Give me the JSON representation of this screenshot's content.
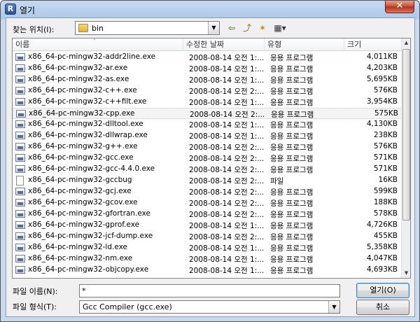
{
  "window": {
    "title": "열기",
    "app_icon_letter": "R",
    "close_glyph": "✕"
  },
  "lookin": {
    "label": "찾는 위치(I):",
    "value": "bin",
    "dropdown_glyph": "▼"
  },
  "toolbar": {
    "back_glyph": "⇦",
    "up_glyph": "⤴",
    "newfolder_glyph": "✶",
    "view_glyph": "▦▾"
  },
  "columns": {
    "name": "이름",
    "date": "수정한 날짜",
    "type": "유형",
    "size": "크기",
    "sort_glyph": "ˆ"
  },
  "files": [
    {
      "name": "x86_64-pc-mingw32-addr2line.exe",
      "date": "2008-08-14 오전 1:...",
      "type": "응용 프로그램",
      "size": "4,011KB",
      "icon": "exe"
    },
    {
      "name": "x86_64-pc-mingw32-ar.exe",
      "date": "2008-08-14 오전 1:...",
      "type": "응용 프로그램",
      "size": "4,203KB",
      "icon": "exe"
    },
    {
      "name": "x86_64-pc-mingw32-as.exe",
      "date": "2008-08-14 오전 1:...",
      "type": "응용 프로그램",
      "size": "5,695KB",
      "icon": "exe"
    },
    {
      "name": "x86_64-pc-mingw32-c++.exe",
      "date": "2008-08-14 오전 2:...",
      "type": "응용 프로그램",
      "size": "576KB",
      "icon": "exe"
    },
    {
      "name": "x86_64-pc-mingw32-c++filt.exe",
      "date": "2008-08-14 오전 1:...",
      "type": "응용 프로그램",
      "size": "3,954KB",
      "icon": "exe"
    },
    {
      "name": "x86_64-pc-mingw32-cpp.exe",
      "date": "2008-08-14 오전 2:...",
      "type": "응용 프로그램",
      "size": "575KB",
      "icon": "exe",
      "selected": true
    },
    {
      "name": "x86_64-pc-mingw32-dlltool.exe",
      "date": "2008-08-14 오전 1:...",
      "type": "응용 프로그램",
      "size": "4,130KB",
      "icon": "exe"
    },
    {
      "name": "x86_64-pc-mingw32-dllwrap.exe",
      "date": "2008-08-14 오전 1:...",
      "type": "응용 프로그램",
      "size": "238KB",
      "icon": "exe"
    },
    {
      "name": "x86_64-pc-mingw32-g++.exe",
      "date": "2008-08-14 오전 2:...",
      "type": "응용 프로그램",
      "size": "576KB",
      "icon": "exe"
    },
    {
      "name": "x86_64-pc-mingw32-gcc.exe",
      "date": "2008-08-14 오전 2:...",
      "type": "응용 프로그램",
      "size": "571KB",
      "icon": "exe"
    },
    {
      "name": "x86_64-pc-mingw32-gcc-4.4.0.exe",
      "date": "2008-08-14 오전 2:...",
      "type": "응용 프로그램",
      "size": "571KB",
      "icon": "exe"
    },
    {
      "name": "x86_64-pc-mingw32-gccbug",
      "date": "2008-08-14 오전 2:...",
      "type": "파일",
      "size": "16KB",
      "icon": "file"
    },
    {
      "name": "x86_64-pc-mingw32-gcj.exe",
      "date": "2008-08-14 오전 2:...",
      "type": "응용 프로그램",
      "size": "599KB",
      "icon": "exe"
    },
    {
      "name": "x86_64-pc-mingw32-gcov.exe",
      "date": "2008-08-14 오전 2:...",
      "type": "응용 프로그램",
      "size": "188KB",
      "icon": "exe"
    },
    {
      "name": "x86_64-pc-mingw32-gfortran.exe",
      "date": "2008-08-14 오전 2:...",
      "type": "응용 프로그램",
      "size": "578KB",
      "icon": "exe"
    },
    {
      "name": "x86_64-pc-mingw32-gprof.exe",
      "date": "2008-08-14 오전 1:...",
      "type": "응용 프로그램",
      "size": "4,726KB",
      "icon": "exe"
    },
    {
      "name": "x86_64-pc-mingw32-jcf-dump.exe",
      "date": "2008-08-14 오전 2:...",
      "type": "응용 프로그램",
      "size": "455KB",
      "icon": "exe"
    },
    {
      "name": "x86_64-pc-mingw32-ld.exe",
      "date": "2008-08-14 오전 1:...",
      "type": "응용 프로그램",
      "size": "5,358KB",
      "icon": "exe"
    },
    {
      "name": "x86_64-pc-mingw32-nm.exe",
      "date": "2008-08-14 오전 1:...",
      "type": "응용 프로그램",
      "size": "4,047KB",
      "icon": "exe"
    },
    {
      "name": "x86_64-pc-mingw32-objcopy.exe",
      "date": "2008-08-14 오전 1:...",
      "type": "응용 프로그램",
      "size": "4,693KB",
      "icon": "exe"
    }
  ],
  "scrollbar": {
    "up_glyph": "▲",
    "down_glyph": "▼"
  },
  "filename": {
    "label": "파일 이름(N):",
    "value": "*"
  },
  "filetype": {
    "label": "파일 형식(T):",
    "value": "Gcc Compiler (gcc.exe)",
    "dropdown_glyph": "▼"
  },
  "buttons": {
    "open": "열기(O)",
    "cancel": "취소"
  }
}
